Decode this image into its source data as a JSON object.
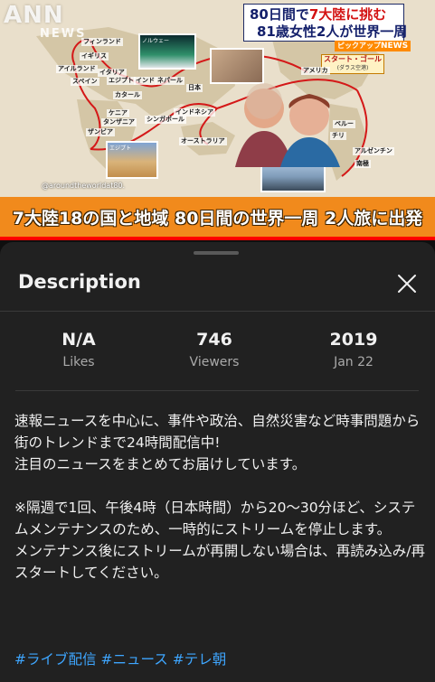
{
  "video": {
    "logo": "ANN",
    "logo_sub": "NEWS",
    "headline_line1_part1": "80日間で",
    "headline_line1_accent": "7大陸に挑む",
    "headline_line2": "81歳女性2人が世界一周",
    "pickup_label": "ピックアップ",
    "pickup_news": "NEWS",
    "start_goal": "スタート・ゴール",
    "start_goal_sub": "(ダラス空港)",
    "credit": "@aroundtheworldat80.",
    "bottom_banner": "7大陸18の国と地域 80日間の世界一周 2人旅に出発",
    "photo_top_label": "ノルウェー",
    "photo_bottom_label": "エジプト",
    "cities": {
      "finland": "フィンランド",
      "england": "イギリス",
      "ireland": "アイルランド",
      "spain": "スペイン",
      "italy": "イタリア",
      "egypt": "エジプト",
      "qatar": "カタール",
      "kenya": "ケニア",
      "tanzania": "タンザニア",
      "zambia": "ザンビア",
      "india": "インド",
      "nepal": "ネパール",
      "japan": "日本",
      "indonesia": "インドネシア",
      "singapore": "シンガポール",
      "australia": "オーストラリア",
      "america": "アメリカ",
      "peru": "ペルー",
      "chile": "チリ",
      "argentina": "アルゼンチン",
      "antarctica": "南極"
    },
    "colors": {
      "banner": "#f18a1c",
      "headline": "#14206b",
      "accent": "#d31212",
      "route": "#d41818"
    }
  },
  "panel": {
    "title": "Description",
    "close_icon": "close-icon",
    "stats": [
      {
        "value": "N/A",
        "label": "Likes"
      },
      {
        "value": "746",
        "label": "Viewers"
      },
      {
        "value": "2019",
        "label": "Jan 22"
      }
    ],
    "description": {
      "p1": "速報ニュースを中心に、事件や政治、自然災害など時事問題から街のトレンドまで24時間配信中!",
      "p2": "注目のニュースをまとめてお届けしています。",
      "p3": "※隔週で1回、午後4時（日本時間）から20〜30分ほど、システムメンテナンスのため、一時的にストリームを停止します。",
      "p4": "メンテナンス後にストリームが再開しない場合は、再読み込み/再スタートしてください。"
    },
    "hashtags": [
      "#ライブ配信",
      "#ニュース",
      "#テレ朝"
    ]
  }
}
